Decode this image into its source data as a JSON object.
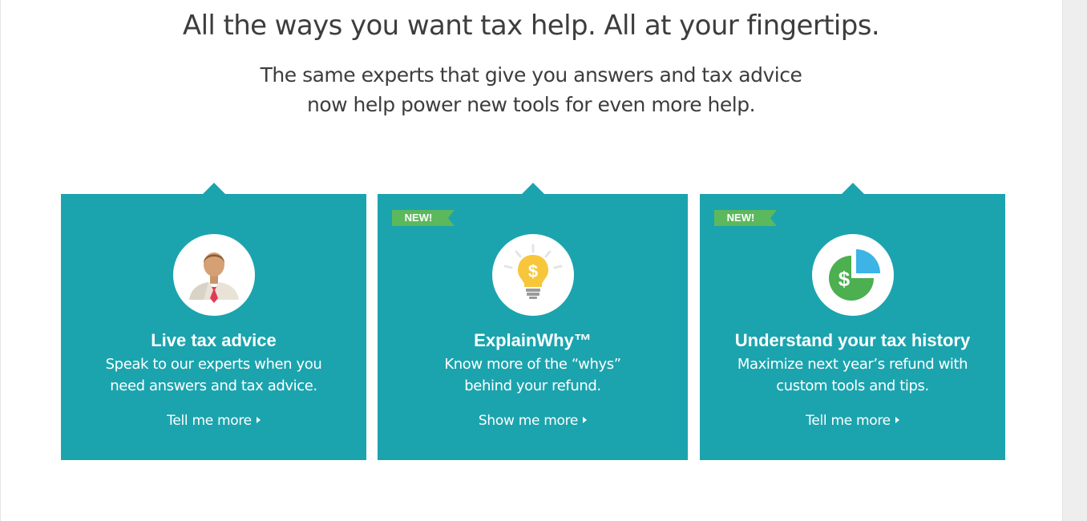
{
  "header": {
    "headline": "All the ways you want tax help. All at your fingertips.",
    "subhead_line1": "The same experts that give you answers and tax advice",
    "subhead_line2": "now help power new tools for even more help."
  },
  "colors": {
    "card_bg": "#1ba4ae",
    "badge_green": "#5cb85c",
    "text_dark": "#3d3d3d"
  },
  "cards": [
    {
      "icon": "expert-person-icon",
      "badge": "",
      "title": "Live tax advice",
      "desc_line1": "Speak to our experts when you",
      "desc_line2": "need answers and tax advice.",
      "link": "Tell me more"
    },
    {
      "icon": "lightbulb-dollar-icon",
      "badge": "NEW!",
      "title": "ExplainWhy™",
      "desc_line1": "Know more of the “whys”",
      "desc_line2": "behind your refund.",
      "link": "Show me more"
    },
    {
      "icon": "pie-chart-dollar-icon",
      "badge": "NEW!",
      "title": "Understand your tax history",
      "desc_line1": "Maximize next year’s refund with",
      "desc_line2": "custom tools and tips.",
      "link": "Tell me more"
    }
  ]
}
